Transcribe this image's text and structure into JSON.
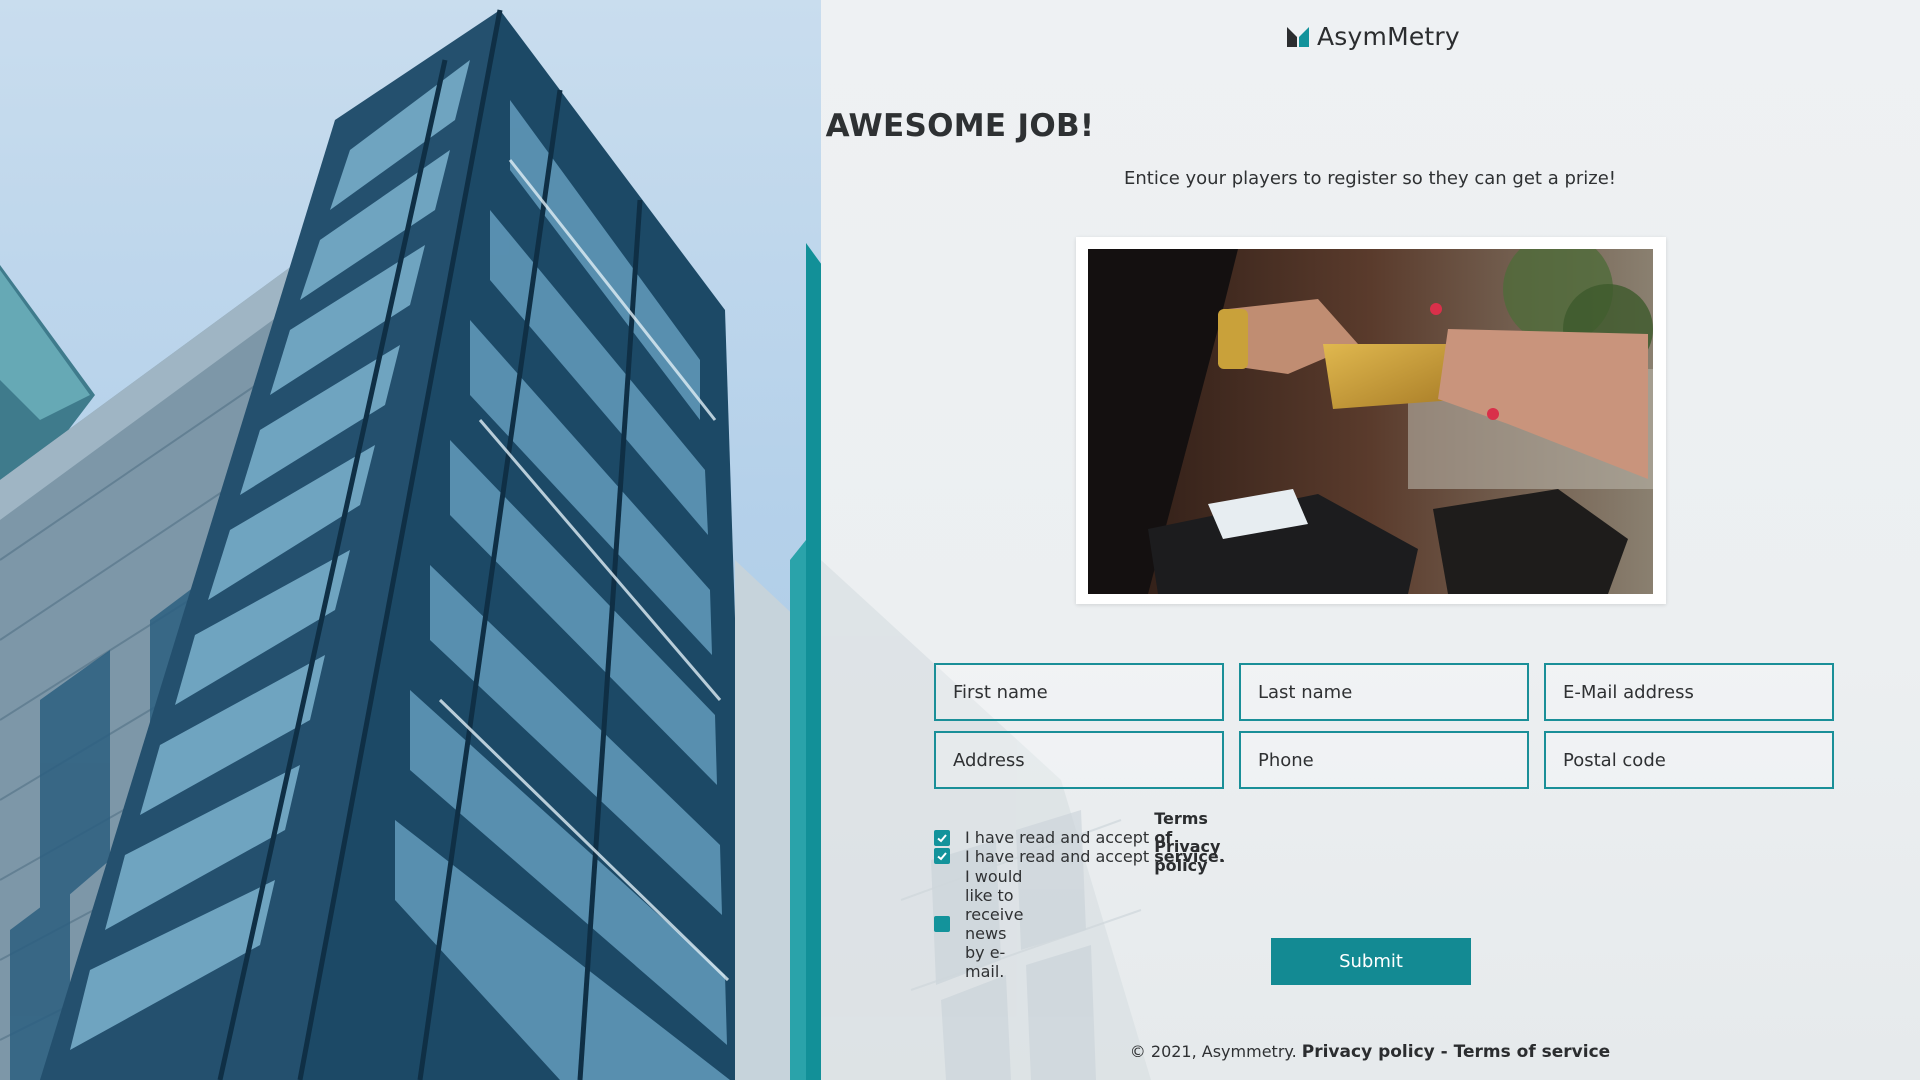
{
  "brand": {
    "name": "AsymMetry"
  },
  "hero": {
    "title": "AWESOME JOB!",
    "subtitle": "Entice your players to register so they can get a prize!"
  },
  "form": {
    "first_name": {
      "placeholder": "First name",
      "value": ""
    },
    "last_name": {
      "placeholder": "Last name",
      "value": ""
    },
    "email": {
      "placeholder": "E-Mail address",
      "value": ""
    },
    "address": {
      "placeholder": "Address",
      "value": ""
    },
    "phone": {
      "placeholder": "Phone",
      "value": ""
    },
    "postal_code": {
      "placeholder": "Postal code",
      "value": ""
    },
    "consents": [
      {
        "prefix": "I have read and accept ",
        "link": "Terms of service.",
        "suffix": "",
        "checked": true
      },
      {
        "prefix": "I have read and accept ",
        "link": "Privacy policy",
        "suffix": ".",
        "checked": true
      },
      {
        "prefix": "I would like to receive news by e-mail.",
        "link": "",
        "suffix": "",
        "checked": false
      }
    ],
    "submit_label": "Submit"
  },
  "footer": {
    "copyright": "© 2021, Asymmetry.",
    "privacy_link": "Privacy policy",
    "separator": " - ",
    "terms_link": "Terms of service"
  },
  "colors": {
    "accent": "#138a93",
    "text": "#2f3133",
    "background": "#eceff1"
  }
}
